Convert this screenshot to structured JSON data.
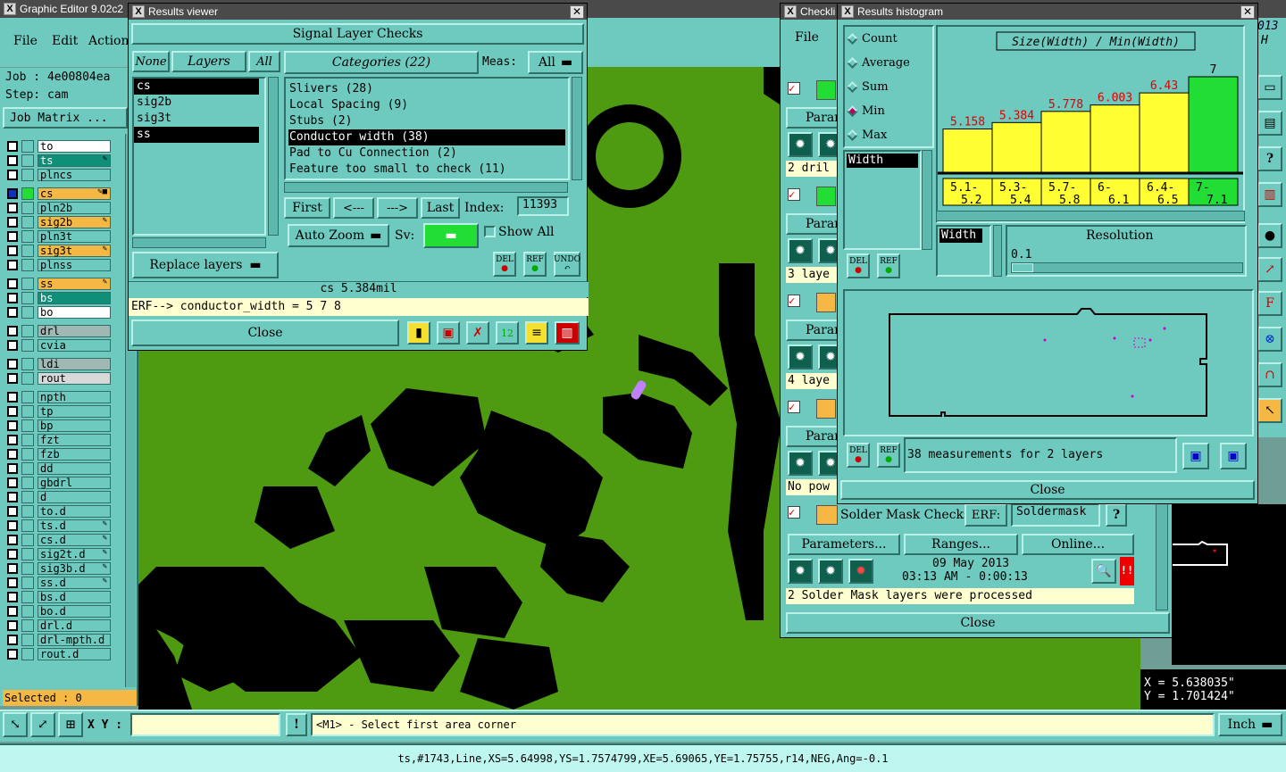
{
  "main": {
    "title": "Graphic Editor 9.02c2",
    "menu": [
      "File",
      "Edit",
      "Action"
    ],
    "job_label": "Job : 4e00804ea",
    "step_label": "Step: cam",
    "job_matrix": "Job Matrix ...",
    "selected": "Selected : 0",
    "xy_label": "X Y :",
    "prompt": "<M1> - Select first area corner",
    "units": "Inch",
    "status": "ts,#1743,Line,XS=5.64998,YS=1.7574799,XE=5.69065,YE=1.75755,r14,NEG,Ang=-0.1",
    "coord_x": "X = 5.638035\"",
    "coord_y": "Y = 1.701424\"",
    "right_top_a": "013",
    "right_top_b": "H"
  },
  "layers": [
    {
      "name": "to",
      "color": "#ffffff",
      "tag": ""
    },
    {
      "name": "ts",
      "color": "#0f8f78",
      "tag": "✎"
    },
    {
      "name": "plncs",
      "color": "#6ec9be",
      "tag": ""
    },
    {
      "name": "cs",
      "color": "#f5b845",
      "tag": "✎■",
      "sel": true
    },
    {
      "name": "pln2b",
      "color": "#6ec9be",
      "tag": ""
    },
    {
      "name": "sig2b",
      "color": "#f5b845",
      "tag": "✎"
    },
    {
      "name": "pln3t",
      "color": "#6ec9be",
      "tag": ""
    },
    {
      "name": "sig3t",
      "color": "#f5b845",
      "tag": "✎"
    },
    {
      "name": "plnss",
      "color": "#6ec9be",
      "tag": ""
    },
    {
      "name": "ss",
      "color": "#f5b845",
      "tag": "✎"
    },
    {
      "name": "bs",
      "color": "#0f8f78",
      "tag": ""
    },
    {
      "name": "bo",
      "color": "#ffffff",
      "tag": ""
    },
    {
      "name": "drl",
      "color": "#a0b8b4",
      "tag": ""
    },
    {
      "name": "cvia",
      "color": "#6ec9be",
      "tag": ""
    },
    {
      "name": "ldi",
      "color": "#a0b8b4",
      "tag": ""
    },
    {
      "name": "rout",
      "color": "#d8d8d8",
      "tag": ""
    },
    {
      "name": "npth",
      "color": "#6ec9be",
      "tag": ""
    },
    {
      "name": "tp",
      "color": "#6ec9be",
      "tag": ""
    },
    {
      "name": "bp",
      "color": "#6ec9be",
      "tag": ""
    },
    {
      "name": "fzt",
      "color": "#6ec9be",
      "tag": ""
    },
    {
      "name": "fzb",
      "color": "#6ec9be",
      "tag": ""
    },
    {
      "name": "dd",
      "color": "#6ec9be",
      "tag": ""
    },
    {
      "name": "gbdrl",
      "color": "#6ec9be",
      "tag": ""
    },
    {
      "name": "d",
      "color": "#6ec9be",
      "tag": ""
    },
    {
      "name": "to.d",
      "color": "#6ec9be",
      "tag": ""
    },
    {
      "name": "ts.d",
      "color": "#6ec9be",
      "tag": "✎"
    },
    {
      "name": "cs.d",
      "color": "#6ec9be",
      "tag": "✎"
    },
    {
      "name": "sig2t.d",
      "color": "#6ec9be",
      "tag": "✎"
    },
    {
      "name": "sig3b.d",
      "color": "#6ec9be",
      "tag": "✎"
    },
    {
      "name": "ss.d",
      "color": "#6ec9be",
      "tag": "✎"
    },
    {
      "name": "bs.d",
      "color": "#6ec9be",
      "tag": ""
    },
    {
      "name": "bo.d",
      "color": "#6ec9be",
      "tag": ""
    },
    {
      "name": "drl.d",
      "color": "#6ec9be",
      "tag": ""
    },
    {
      "name": "drl-mpth.d",
      "color": "#6ec9be",
      "tag": ""
    },
    {
      "name": "rout.d",
      "color": "#6ec9be",
      "tag": ""
    }
  ],
  "results": {
    "title": "Results viewer",
    "header": "Signal Layer Checks",
    "none": "None",
    "layers_label": "Layers",
    "all": "All",
    "categories_label": "Categories (22)",
    "meas_label": "Meas:",
    "meas_value": "All",
    "layer_list": [
      "cs",
      "sig2b",
      "sig3t",
      "ss"
    ],
    "categories": [
      "Slivers (28)",
      "Local Spacing (9)",
      "Stubs (2)",
      "Conductor width (38)",
      "Pad to Cu Connection (2)",
      "Feature too small to check (11)"
    ],
    "first": "First",
    "prev": "<---",
    "next": "--->",
    "last": "Last",
    "index_label": "Index:",
    "index_value": "11393",
    "auto_zoom": "Auto Zoom",
    "sv": "Sv:",
    "show_all": "Show All",
    "replace_layers": "Replace layers",
    "del": "DEL",
    "ref": "REF",
    "undo": "UNDO",
    "value_line": "cs 5.384mil",
    "erf_line": "ERF--> conductor_width = 5 7 8",
    "close": "Close"
  },
  "checklist": {
    "title": "Checkli",
    "file": "File",
    "rows": [
      {
        "btn": "Param",
        "info": "2 dril"
      },
      {
        "btn": "Param",
        "info": "3 laye"
      },
      {
        "btn": "Param",
        "info": "4 laye"
      },
      {
        "btn": "Param",
        "info": "No pow"
      }
    ],
    "solder_title": "Solder Mask Checks",
    "erf": "ERF:",
    "erf_value": "Soldermask",
    "q": "?",
    "parameters": "Parameters...",
    "ranges": "Ranges...",
    "online": "Online...",
    "date": "09 May 2013",
    "time": "03:13 AM - 0:00:13",
    "processed": "2 Solder Mask layers were processed",
    "close": "Close"
  },
  "histogram": {
    "title": "Results histogram",
    "options": [
      "Count",
      "Average",
      "Sum",
      "Min",
      "Max"
    ],
    "selected_option": "Min",
    "field": "Width",
    "chart_title": "Size(Width) / Min(Width)",
    "resolution_label": "Resolution",
    "resolution_value": "0.1",
    "width_label": "Width",
    "summary": "38 measurements for 2 layers",
    "close": "Close",
    "del": "DEL",
    "ref": "REF"
  },
  "chart_data": {
    "type": "bar",
    "title": "Size(Width) / Min(Width)",
    "categories": [
      "5.1-5.2",
      "5.3-5.4",
      "5.7-5.8",
      "6-6.1",
      "6.4-6.5",
      "7-7.1"
    ],
    "values": [
      5.158,
      5.384,
      5.778,
      6.003,
      6.43,
      7
    ],
    "labels": [
      "5.158",
      "5.384",
      "5.778",
      "6.003",
      "6.43",
      "7"
    ],
    "colors": [
      "#ffff33",
      "#ffff33",
      "#ffff33",
      "#ffff33",
      "#ffff33",
      "#22dd33"
    ]
  }
}
